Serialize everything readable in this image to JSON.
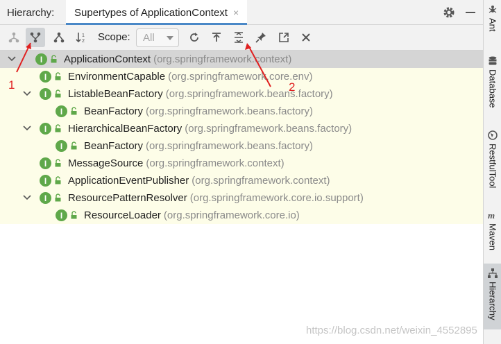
{
  "header": {
    "title": "Hierarchy:",
    "tab_label": "Supertypes of ApplicationContext",
    "tab_close": "×"
  },
  "toolbar": {
    "scope_label": "Scope:",
    "scope_value": "All"
  },
  "tree": {
    "rows": [
      {
        "name": "ApplicationContext",
        "pkg": "(org.springframework.context)"
      },
      {
        "name": "EnvironmentCapable",
        "pkg": "(org.springframework.core.env)"
      },
      {
        "name": "ListableBeanFactory",
        "pkg": "(org.springframework.beans.factory)"
      },
      {
        "name": "BeanFactory",
        "pkg": "(org.springframework.beans.factory)"
      },
      {
        "name": "HierarchicalBeanFactory",
        "pkg": "(org.springframework.beans.factory)"
      },
      {
        "name": "BeanFactory",
        "pkg": "(org.springframework.beans.factory)"
      },
      {
        "name": "MessageSource",
        "pkg": "(org.springframework.context)"
      },
      {
        "name": "ApplicationEventPublisher",
        "pkg": "(org.springframework.context)"
      },
      {
        "name": "ResourcePatternResolver",
        "pkg": "(org.springframework.core.io.support)"
      },
      {
        "name": "ResourceLoader",
        "pkg": "(org.springframework.core.io)"
      }
    ]
  },
  "sidebar": {
    "items": [
      {
        "label": "Ant",
        "icon": "ant-icon"
      },
      {
        "label": "Database",
        "icon": "database-icon"
      },
      {
        "label": "RestfulTool",
        "icon": "globe-icon"
      },
      {
        "label": "Maven",
        "icon": "maven-icon"
      },
      {
        "label": "Hierarchy",
        "icon": "hierarchy-icon"
      }
    ]
  },
  "annotations": {
    "label_1": "1",
    "label_2": "2"
  },
  "watermark": "https://blog.csdn.net/weixin_4552895",
  "colors": {
    "accent": "#4a88c7",
    "interface_icon": "#5fa84a",
    "annotation": "#e02020",
    "highlight_bg": "#fdfde8"
  }
}
